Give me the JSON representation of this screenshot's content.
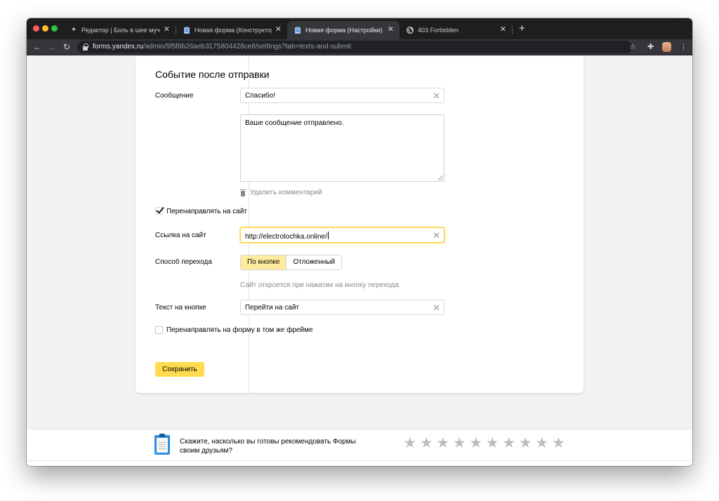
{
  "browser": {
    "tabs": [
      {
        "title": "Редактор | Боль в шее мучает?",
        "icon": "plus-favicon-icon"
      },
      {
        "title": "Новая форма (Конструктор) — Яндекс.Формы",
        "icon": "forms-favicon-icon"
      },
      {
        "title": "Новая форма (Настройки) — Яндекс.Формы",
        "icon": "forms-favicon-icon"
      },
      {
        "title": "403 Forbidden",
        "icon": "globe-icon"
      }
    ],
    "active_tab": 2,
    "url_host": "forms.yandex.ru",
    "url_path": "/admin/5f5f6b26aeb3175804428ce8/settings?tab=texts-and-submit"
  },
  "form": {
    "heading": "Событие после отправки",
    "message_label": "Сообщение",
    "message_title_value": "Спасибо!",
    "message_body_value": "Ваше сообщение отправлено.",
    "delete_comment": "Удалить комментарий",
    "redirect_label": "Перенаправлять на сайт",
    "redirect_checked": true,
    "site_link_label": "Ссылка на сайт",
    "site_link_value": "http://electrotochka.online/",
    "transition_label": "Способ перехода",
    "transition_options": [
      "По кнопке",
      "Отложенный"
    ],
    "transition_selected": "По кнопке",
    "transition_hint": "Сайт откроется при нажатии на кнопку перехода.",
    "button_text_label": "Текст на кнопке",
    "button_text_value": "Перейти на сайт",
    "same_frame_label": "Перенаправлять на форму в том же фрейме",
    "same_frame_checked": false,
    "save_label": "Сохранить"
  },
  "footer": {
    "survey_text": "Скажите, насколько вы готовы рекомендовать Формы своим друзьям?",
    "star_count": 10
  },
  "colors": {
    "accent_yellow": "#ffdb4d",
    "segment_active": "#ffeba0",
    "focus_border": "#ffd84a"
  }
}
